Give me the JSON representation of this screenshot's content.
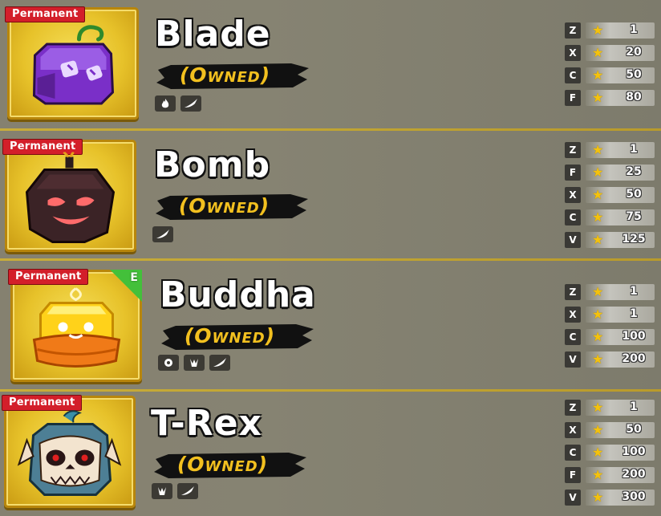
{
  "fruits": [
    {
      "name": "Blade",
      "badge": "Permanent",
      "status": "(Owned)",
      "corner": "",
      "type_icons": [
        "flame-icon",
        "slash-icon"
      ],
      "moves": [
        {
          "key": "Z",
          "level": "1"
        },
        {
          "key": "X",
          "level": "20"
        },
        {
          "key": "C",
          "level": "50"
        },
        {
          "key": "F",
          "level": "80"
        }
      ]
    },
    {
      "name": "Bomb",
      "badge": "Permanent",
      "status": "(Owned)",
      "corner": "",
      "type_icons": [
        "slash-icon"
      ],
      "moves": [
        {
          "key": "Z",
          "level": "1"
        },
        {
          "key": "F",
          "level": "25"
        },
        {
          "key": "X",
          "level": "50"
        },
        {
          "key": "C",
          "level": "75"
        },
        {
          "key": "V",
          "level": "125"
        }
      ]
    },
    {
      "name": "Buddha",
      "badge": "Permanent",
      "status": "(Owned)",
      "corner": "E",
      "type_icons": [
        "shield-icon",
        "claw-icon",
        "slash-icon"
      ],
      "moves": [
        {
          "key": "Z",
          "level": "1"
        },
        {
          "key": "X",
          "level": "1"
        },
        {
          "key": "C",
          "level": "100"
        },
        {
          "key": "V",
          "level": "200"
        }
      ]
    },
    {
      "name": "T-Rex",
      "badge": "Permanent",
      "status": "(Owned)",
      "corner": "",
      "type_icons": [
        "claw-icon",
        "slash-icon"
      ],
      "moves": [
        {
          "key": "Z",
          "level": "1"
        },
        {
          "key": "X",
          "level": "50"
        },
        {
          "key": "C",
          "level": "100"
        },
        {
          "key": "F",
          "level": "200"
        },
        {
          "key": "V",
          "level": "300"
        }
      ]
    }
  ],
  "colors": {
    "accent_gold": "#f2c01f",
    "badge_red": "#d31f2a",
    "row_bg": "#858170",
    "separator": "#c8ad3a",
    "corner_green": "#43c03a"
  }
}
